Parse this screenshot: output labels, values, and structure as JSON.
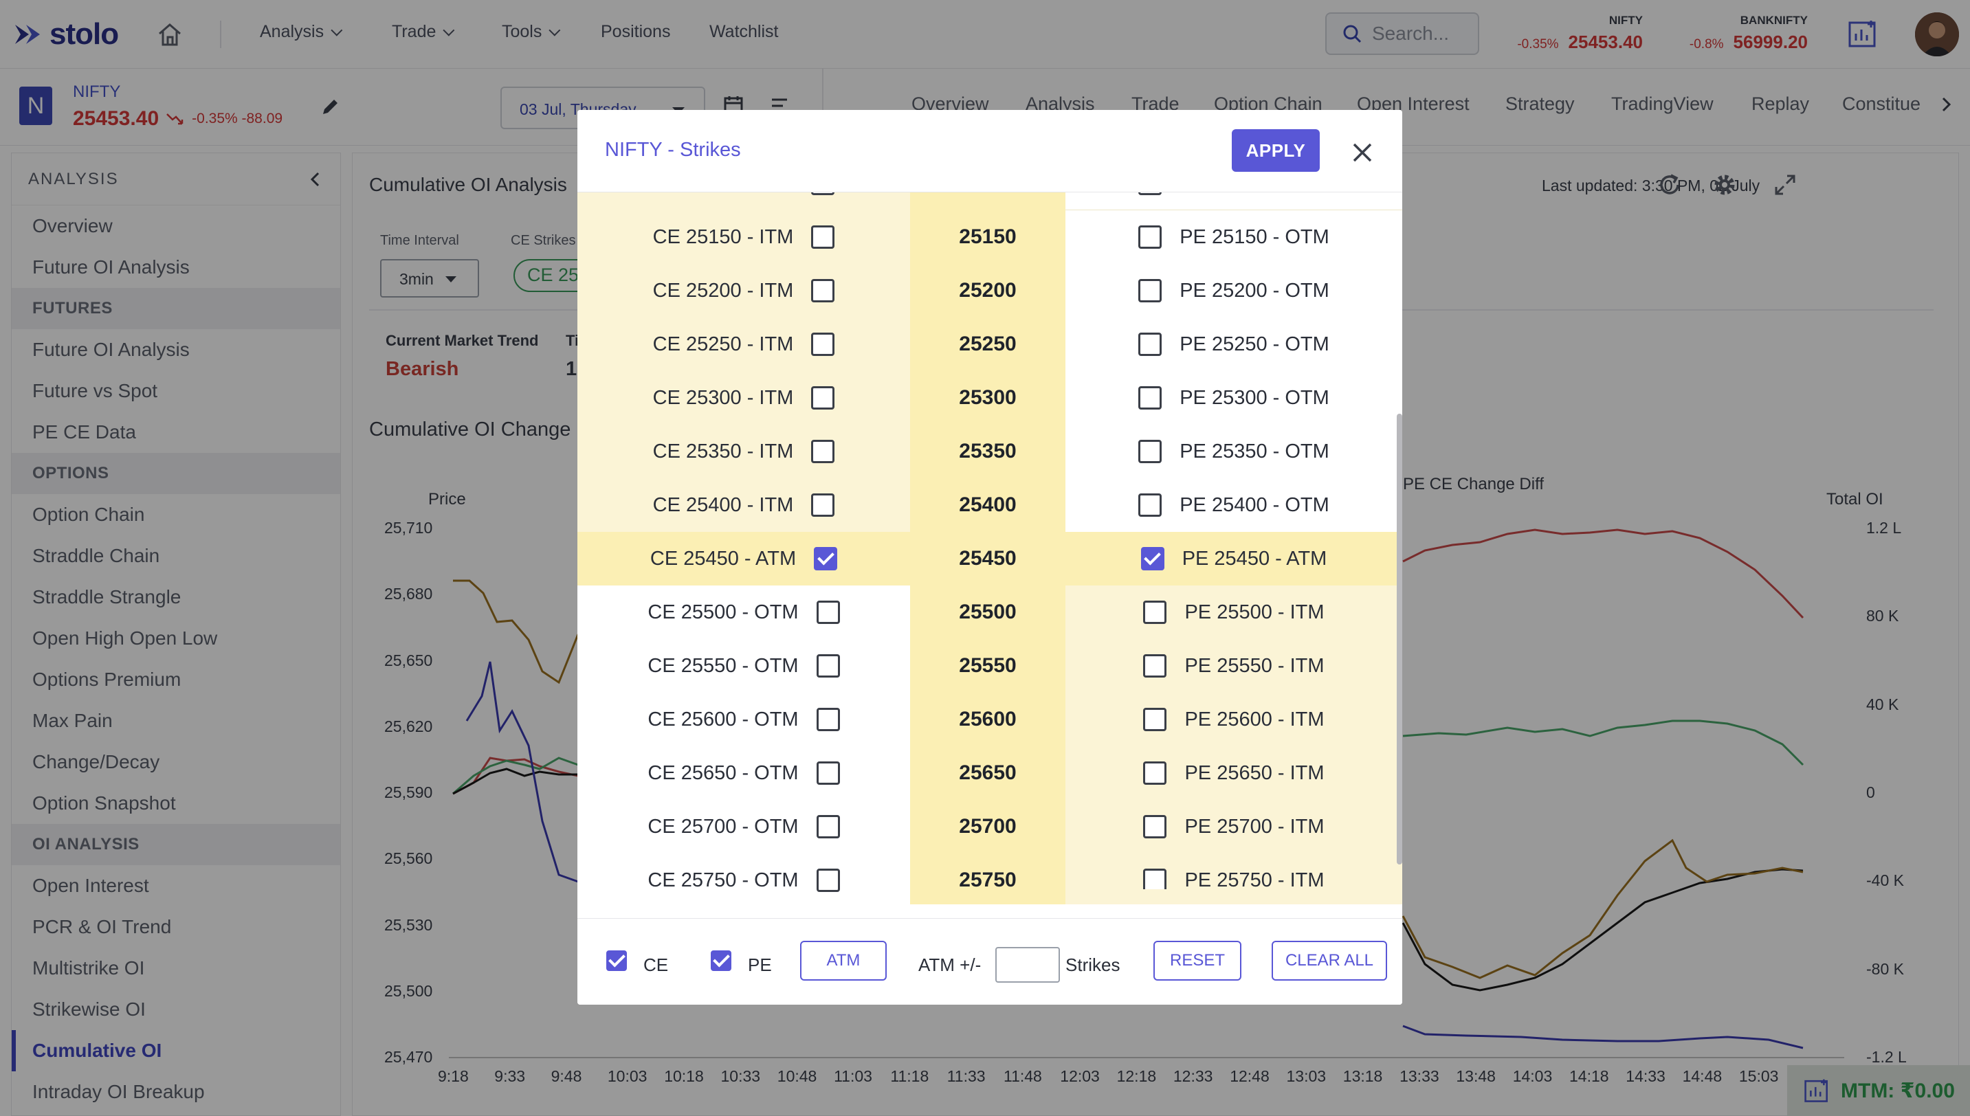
{
  "brand": {
    "name": "stolo"
  },
  "topnav": {
    "items": [
      "Analysis",
      "Trade",
      "Tools",
      "Positions",
      "Watchlist"
    ],
    "search_placeholder": "Search...",
    "indices": [
      {
        "name": "NIFTY",
        "change": "-0.35%",
        "value": "25453.40"
      },
      {
        "name": "BANKNIFTY",
        "change": "-0.8%",
        "value": "56999.20"
      }
    ]
  },
  "symbol": {
    "badge": "N",
    "name": "NIFTY",
    "price": "25453.40",
    "change": "-0.35% -88.09"
  },
  "date_select": {
    "value": "03 Jul, Thursday"
  },
  "tabs": [
    "Overview",
    "Analysis",
    "Trade",
    "Option Chain",
    "Open Interest",
    "Strategy",
    "TradingView",
    "Replay",
    "Constitue"
  ],
  "sidebar": {
    "header": "ANALYSIS",
    "top_items": [
      "Overview",
      "Future OI Analysis"
    ],
    "sections": [
      {
        "title": "FUTURES",
        "items": [
          "Future OI Analysis",
          "Future vs Spot",
          "PE CE Data"
        ]
      },
      {
        "title": "OPTIONS",
        "items": [
          "Option Chain",
          "Straddle Chain",
          "Straddle Strangle",
          "Open High Open Low",
          "Options Premium",
          "Max Pain",
          "Change/Decay",
          "Option Snapshot"
        ]
      },
      {
        "title": "OI ANALYSIS",
        "items": [
          "Open Interest",
          "PCR & OI Trend",
          "Multistrike OI",
          "Strikewise OI",
          "Cumulative OI",
          "Intraday OI Breakup"
        ]
      }
    ],
    "active": "Cumulative OI"
  },
  "content": {
    "title": "Cumulative OI Analysis",
    "last_updated": "Last updated: 3:30 PM, 02 July",
    "time_interval_label": "Time Interval",
    "time_interval_value": "3min",
    "ce_strikes_label": "CE Strikes",
    "ce_strikes_value": "CE 25",
    "trend_label": "Current Market Trend",
    "trend_value": "Bearish",
    "trend_extra_label": "Ti",
    "trend_extra_value": "1:",
    "chart_title": "Cumulative OI Change"
  },
  "chart_data": {
    "type": "line",
    "y_left_label": "Price",
    "y_right_label": "Total OI",
    "middle_label": "PE CE Change Diff",
    "y_left_ticks": [
      "25,710",
      "25,680",
      "25,650",
      "25,620",
      "25,590",
      "25,560",
      "25,530",
      "25,500",
      "25,470"
    ],
    "y_right_ticks": [
      "1.2 L",
      "80 K",
      "40 K",
      "0",
      "-40 K",
      "-80 K",
      "-1.2 L"
    ],
    "x_ticks": [
      "9:18",
      "9:33",
      "9:48",
      "10:03",
      "10:18",
      "10:33",
      "10:48",
      "11:03",
      "11:18",
      "11:33",
      "11:48",
      "12:03",
      "12:18",
      "12:33",
      "12:48",
      "13:03",
      "13:18",
      "13:33",
      "13:48",
      "14:03",
      "14:18",
      "14:33",
      "14:48",
      "15:03"
    ],
    "colors": {
      "price": "#1a1a1a",
      "blue": "#3a3ab0",
      "brown": "#9a7020",
      "green": "#4aa56a",
      "red": "#c84a4a"
    }
  },
  "modal": {
    "title": "NIFTY - Strikes",
    "apply_label": "APPLY",
    "rows": [
      {
        "ce": "CE 25150 - ITM",
        "strike": "25150",
        "pe": "PE 25150 - OTM",
        "ce_checked": false,
        "pe_checked": false,
        "atm": false
      },
      {
        "ce": "CE 25200 - ITM",
        "strike": "25200",
        "pe": "PE 25200 - OTM",
        "ce_checked": false,
        "pe_checked": false,
        "atm": false
      },
      {
        "ce": "CE 25250 - ITM",
        "strike": "25250",
        "pe": "PE 25250 - OTM",
        "ce_checked": false,
        "pe_checked": false,
        "atm": false
      },
      {
        "ce": "CE 25300 - ITM",
        "strike": "25300",
        "pe": "PE 25300 - OTM",
        "ce_checked": false,
        "pe_checked": false,
        "atm": false
      },
      {
        "ce": "CE 25350 - ITM",
        "strike": "25350",
        "pe": "PE 25350 - OTM",
        "ce_checked": false,
        "pe_checked": false,
        "atm": false
      },
      {
        "ce": "CE 25400 - ITM",
        "strike": "25400",
        "pe": "PE 25400 - OTM",
        "ce_checked": false,
        "pe_checked": false,
        "atm": false
      },
      {
        "ce": "CE 25450 - ATM",
        "strike": "25450",
        "pe": "PE 25450 - ATM",
        "ce_checked": true,
        "pe_checked": true,
        "atm": true
      },
      {
        "ce": "CE 25500 - OTM",
        "strike": "25500",
        "pe": "PE 25500 - ITM",
        "ce_checked": false,
        "pe_checked": false,
        "atm": false
      },
      {
        "ce": "CE 25550 - OTM",
        "strike": "25550",
        "pe": "PE 25550 - ITM",
        "ce_checked": false,
        "pe_checked": false,
        "atm": false
      },
      {
        "ce": "CE 25600 - OTM",
        "strike": "25600",
        "pe": "PE 25600 - ITM",
        "ce_checked": false,
        "pe_checked": false,
        "atm": false
      },
      {
        "ce": "CE 25650 - OTM",
        "strike": "25650",
        "pe": "PE 25650 - ITM",
        "ce_checked": false,
        "pe_checked": false,
        "atm": false
      },
      {
        "ce": "CE 25700 - OTM",
        "strike": "25700",
        "pe": "PE 25700 - ITM",
        "ce_checked": false,
        "pe_checked": false,
        "atm": false
      },
      {
        "ce": "CE 25750 - OTM",
        "strike": "25750",
        "pe": "PE 25750 - ITM",
        "ce_checked": false,
        "pe_checked": false,
        "atm": false
      }
    ],
    "footer": {
      "ce_label": "CE",
      "ce_checked": true,
      "pe_label": "PE",
      "pe_checked": true,
      "atm_button": "ATM",
      "atm_range_label": "ATM +/-",
      "atm_range_value": "",
      "strikes_label": "Strikes",
      "reset_label": "RESET",
      "clear_all_label": "CLEAR ALL"
    }
  },
  "mtm": {
    "label": "MTM: ₹0.00"
  }
}
